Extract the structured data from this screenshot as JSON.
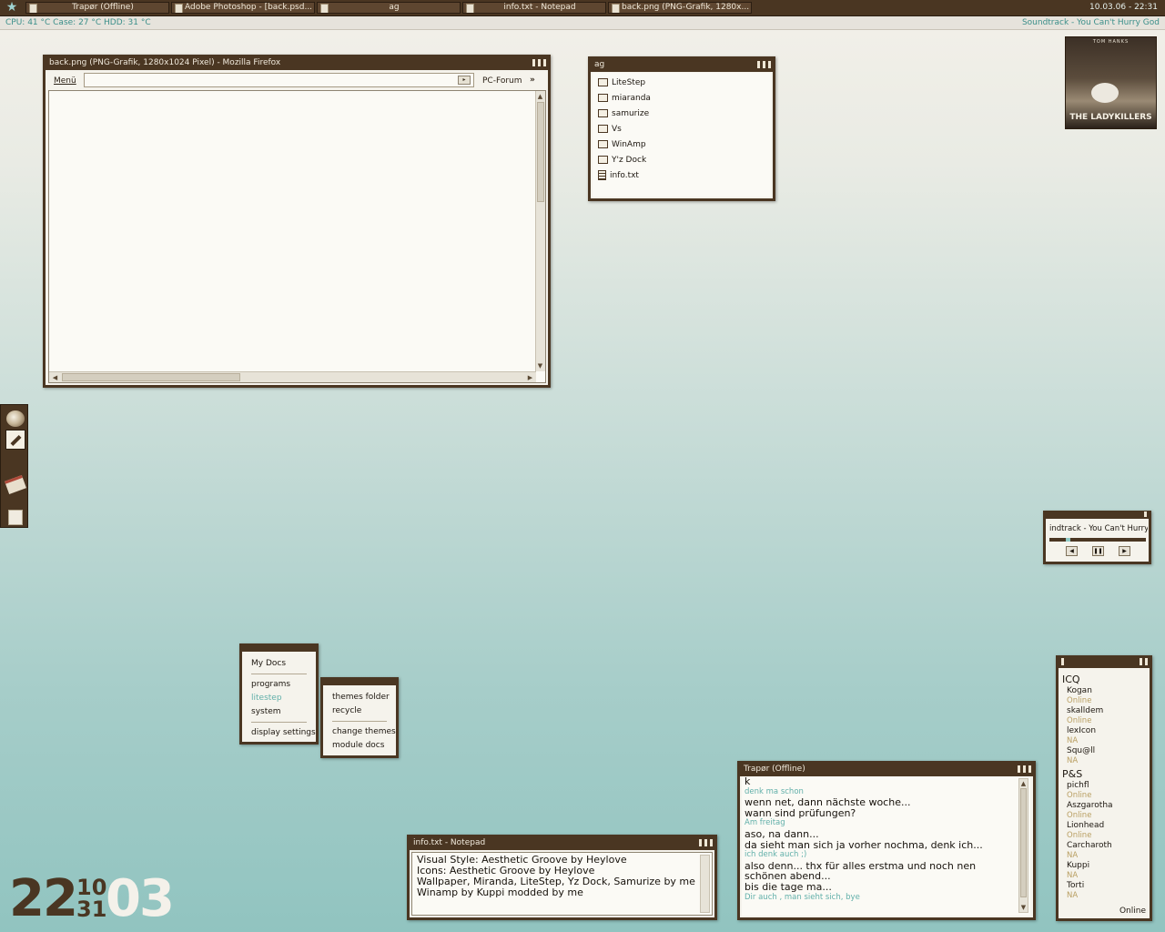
{
  "taskbar": {
    "tasks": [
      {
        "label": "Trapør (Offline)"
      },
      {
        "label": "Adobe Photoshop - [back.psd..."
      },
      {
        "label": "ag"
      },
      {
        "label": "info.txt - Notepad"
      },
      {
        "label": "back.png (PNG-Grafik, 1280x..."
      }
    ],
    "datetime": "10.03.06 - 22:31"
  },
  "status": {
    "stats": "CPU: 41 °C  Case: 27 °C  HDD: 31 °C",
    "soundtrack": "Soundtrack - You Can't Hurry God"
  },
  "album": {
    "top_text": "TOM HANKS",
    "logo_text": "THE LADYKILLERS"
  },
  "firefox": {
    "title": "back.png (PNG-Grafik, 1280x1024 Pixel) - Mozilla Firefox",
    "menu": "Menü",
    "url": "",
    "forum": "PC-Forum",
    "more": "»"
  },
  "explorer": {
    "title": "ag",
    "items": [
      {
        "label": "LiteStep",
        "type": "folder"
      },
      {
        "label": "miaranda",
        "type": "folder"
      },
      {
        "label": "samurize",
        "type": "folder"
      },
      {
        "label": "Vs",
        "type": "folder"
      },
      {
        "label": "WinAmp",
        "type": "folder"
      },
      {
        "label": "Y'z Dock",
        "type": "folder"
      },
      {
        "label": "info.txt",
        "type": "file"
      }
    ]
  },
  "winamp": {
    "track": "indtrack - You Can't Hurry",
    "progress": 0.18
  },
  "menu_main": {
    "items": [
      "My Docs",
      "programs",
      "litestep",
      "system",
      "display settings"
    ]
  },
  "menu_sub": {
    "items": [
      "themes folder",
      "recycle",
      "change themes",
      "module docs"
    ]
  },
  "notepad": {
    "title": "info.txt - Notepad",
    "lines": [
      "Visual Style: Aesthetic Groove by Heylove",
      "Icons: Aesthetic Groove by Heylove",
      "Wallpaper, Miranda, LiteStep, Yz Dock, Samurize by me",
      "Winamp by Kuppi modded by me"
    ]
  },
  "chat": {
    "title": "Trapør (Offline)",
    "lines": [
      {
        "text": "k",
        "small": false
      },
      {
        "text": "denk ma schon",
        "small": true
      },
      {
        "text": "wenn net, dann nächste woche...",
        "small": false
      },
      {
        "text": "wann sind prüfungen?",
        "small": false
      },
      {
        "text": "Am freitag",
        "small": true
      },
      {
        "text": "aso, na dann...",
        "small": false
      },
      {
        "text": "da sieht man sich ja vorher nochma, denk ich...",
        "small": false
      },
      {
        "text": "ich denk auch ;)",
        "small": true
      },
      {
        "text": "also denn... thx für alles erstma und noch nen",
        "small": false
      },
      {
        "text": "schönen abend...",
        "small": false
      },
      {
        "text": "bis die tage ma...",
        "small": false
      },
      {
        "text": "Dir auch , man sieht sich, bye",
        "small": true
      }
    ]
  },
  "icq": {
    "groups": [
      {
        "name": "ICQ",
        "contacts": [
          {
            "name": "Kogan",
            "status": "Online"
          },
          {
            "name": "skalldem",
            "status": "Online"
          },
          {
            "name": "lexIcon",
            "status": "NA"
          },
          {
            "name": "Squ@ll",
            "status": "NA"
          }
        ]
      },
      {
        "name": "P&S",
        "contacts": [
          {
            "name": "pichfl",
            "status": "Online"
          },
          {
            "name": "Aszgarotha",
            "status": "Online"
          },
          {
            "name": "Lionhead",
            "status": "Online"
          },
          {
            "name": "Carcharoth",
            "status": "NA"
          },
          {
            "name": "Kuppi",
            "status": "NA"
          },
          {
            "name": "Torti",
            "status": "NA"
          }
        ]
      }
    ],
    "my_status": "Online"
  },
  "clock": {
    "hour": "22",
    "date_top": "10",
    "date_bottom": "31",
    "minute": "03"
  },
  "colors": {
    "frame": "#4a3622",
    "accent": "#62b0aa",
    "status_text": "#b99f62"
  }
}
